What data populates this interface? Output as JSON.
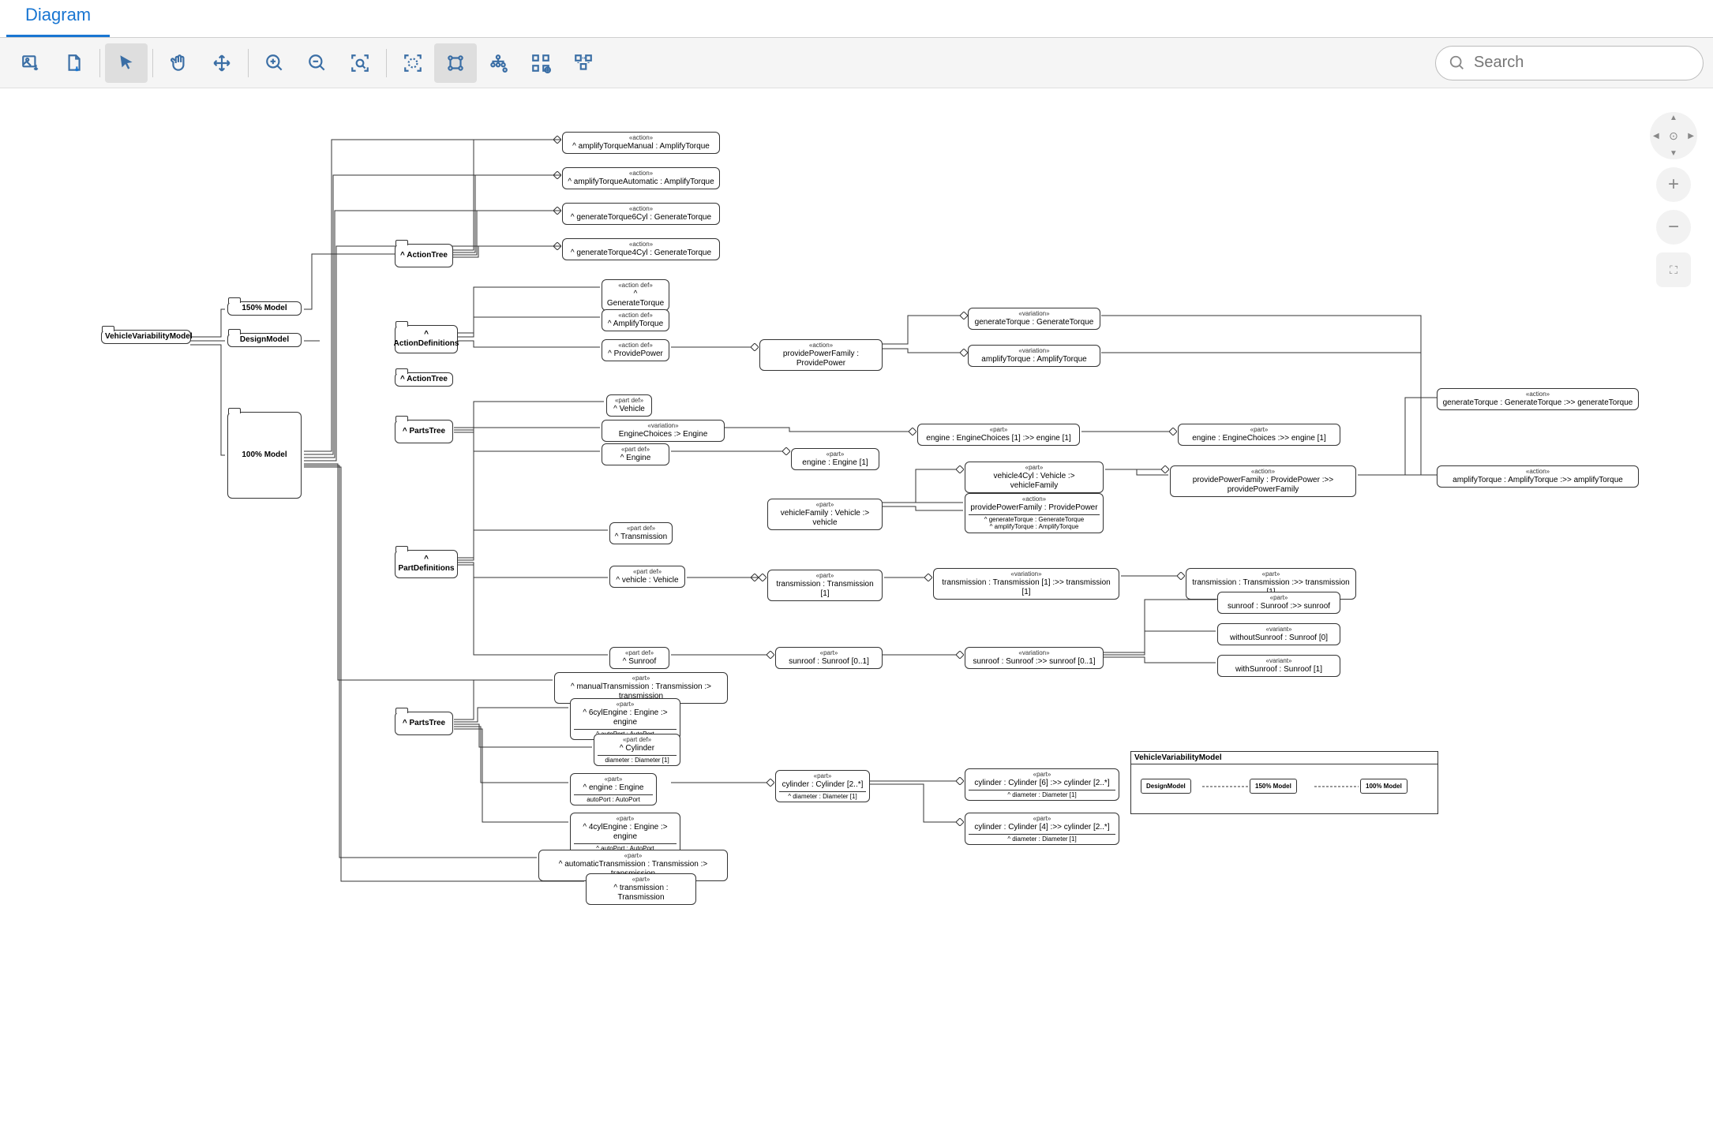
{
  "tab": {
    "label": "Diagram"
  },
  "search": {
    "placeholder": "Search"
  },
  "toolbar": {
    "tools": [
      {
        "name": "image-export-icon"
      },
      {
        "name": "page-icon"
      },
      {
        "name": "pointer-icon",
        "active": true
      },
      {
        "name": "pan-icon"
      },
      {
        "name": "move-icon"
      },
      {
        "name": "zoom-in-icon"
      },
      {
        "name": "zoom-out-icon"
      },
      {
        "name": "zoom-region-icon"
      },
      {
        "name": "fit-icon"
      },
      {
        "name": "layout-icon",
        "active": true
      },
      {
        "name": "layout-tree-icon"
      },
      {
        "name": "distribute-icon"
      },
      {
        "name": "align-icon"
      }
    ]
  },
  "nodes": {
    "root": "VehicleVariabilityModel",
    "model150a": "150% Model",
    "designModel": "DesignModel",
    "model100": "100% Model",
    "actionTree1": "^ ActionTree",
    "actionTree2": "^ ActionTree",
    "actionDefs": "^ ActionDefinitions",
    "partsTree1": "^ PartsTree",
    "partDefs": "^ PartDefinitions",
    "partsTree2": "^ PartsTree",
    "amplifyManual": {
      "stereo": "«action»",
      "label": "^ amplifyTorqueManual : AmplifyTorque"
    },
    "amplifyAuto": {
      "stereo": "«action»",
      "label": "^ amplifyTorqueAutomatic : AmplifyTorque"
    },
    "genTorque6": {
      "stereo": "«action»",
      "label": "^ generateTorque6Cyl : GenerateTorque"
    },
    "genTorque4": {
      "stereo": "«action»",
      "label": "^ generateTorque4Cyl : GenerateTorque"
    },
    "genTorqueDef": {
      "stereo": "«action def»",
      "label": "^ GenerateTorque"
    },
    "amplifyDef": {
      "stereo": "«action def»",
      "label": "^ AmplifyTorque"
    },
    "providePowerDef": {
      "stereo": "«action def»",
      "label": "^ ProvidePower"
    },
    "providePowerFamily": {
      "stereo": "«action»",
      "label": "providePowerFamily : ProvidePower"
    },
    "genTorqueVar": {
      "stereo": "«variation»",
      "label": "generateTorque : GenerateTorque"
    },
    "amplifyVar": {
      "stereo": "«variation»",
      "label": "amplifyTorque : AmplifyTorque"
    },
    "genTorqueAction": {
      "stereo": "«action»",
      "label": "generateTorque : GenerateTorque :>> generateTorque"
    },
    "amplifyAction": {
      "stereo": "«action»",
      "label": "amplifyTorque : AmplifyTorque :>> amplifyTorque"
    },
    "vehicleDef": {
      "stereo": "«part def»",
      "label": "^ Vehicle"
    },
    "engineChoicesVar": {
      "stereo": "«variation»",
      "label": "EngineChoices :> Engine"
    },
    "engineDef": {
      "stereo": "«part def»",
      "label": "^ Engine"
    },
    "enginePart": {
      "stereo": "«part»",
      "label": "engine : Engine [1]"
    },
    "engineChoicesPart": {
      "stereo": "«part»",
      "label": "engine : EngineChoices [1] :>> engine [1]"
    },
    "engineChoicesPart2": {
      "stereo": "«part»",
      "label": "engine : EngineChoices :>> engine [1]"
    },
    "vehicle4Cyl": {
      "stereo": "«part»",
      "label": "vehicle4Cyl : Vehicle :> vehicleFamily"
    },
    "vehicleFamily": {
      "stereo": "«part»",
      "label": "vehicleFamily : Vehicle :> vehicle"
    },
    "providePowerFamily2": {
      "stereo": "«action»",
      "label": "providePowerFamily : ProvidePower",
      "c1": "^ generateTorque : GenerateTorque",
      "c2": "^ amplifyTorque : AmplifyTorque"
    },
    "providePowerAction": {
      "stereo": "«action»",
      "label": "providePowerFamily : ProvidePower :>> providePowerFamily"
    },
    "transmissionDef": {
      "stereo": "«part def»",
      "label": "^ Transmission"
    },
    "vehicleDef2": {
      "stereo": "«part def»",
      "label": "^ vehicle : Vehicle"
    },
    "transmissionPart": {
      "stereo": "«part»",
      "label": "transmission : Transmission [1]"
    },
    "transmissionVar": {
      "stereo": "«variation»",
      "label": "transmission : Transmission [1] :>> transmission [1]"
    },
    "transmissionPart2": {
      "stereo": "«part»",
      "label": "transmission : Transmission :>> transmission [1]"
    },
    "sunroofPart": {
      "stereo": "«part»",
      "label": "sunroof : Sunroof :>> sunroof"
    },
    "withoutSunroof": {
      "stereo": "«variant»",
      "label": "withoutSunroof : Sunroof [0]"
    },
    "withSunroof": {
      "stereo": "«variant»",
      "label": "withSunroof : Sunroof [1]"
    },
    "sunroofDef": {
      "stereo": "«part def»",
      "label": "^ Sunroof"
    },
    "sunroofPart01": {
      "stereo": "«part»",
      "label": "sunroof : Sunroof [0..1]"
    },
    "sunroofVar": {
      "stereo": "«variation»",
      "label": "sunroof : Sunroof :>> sunroof [0..1]"
    },
    "manualTrans": {
      "stereo": "«part»",
      "label": "^ manualTransmission : Transmission :> transmission"
    },
    "sixCylEngine": {
      "stereo": "«part»",
      "label": "^ 6cylEngine : Engine :> engine",
      "c1": "^ autoPort : AutoPort"
    },
    "cylinderDef": {
      "stereo": "«part def»",
      "label": "^ Cylinder",
      "c1": "diameter : Diameter [1]"
    },
    "engineEngine": {
      "stereo": "«part»",
      "label": "^ engine : Engine",
      "c1": "autoPort : AutoPort"
    },
    "cylinderPart": {
      "stereo": "«part»",
      "label": "cylinder : Cylinder [2..*]",
      "c1": "^ diameter : Diameter [1]"
    },
    "cylinder6": {
      "stereo": "«part»",
      "label": "cylinder : Cylinder [6] :>> cylinder [2..*]",
      "c1": "^ diameter : Diameter [1]"
    },
    "cylinder4": {
      "stereo": "«part»",
      "label": "cylinder : Cylinder [4] :>> cylinder [2..*]",
      "c1": "^ diameter : Diameter [1]"
    },
    "fourCylEngine": {
      "stereo": "«part»",
      "label": "^ 4cylEngine : Engine :> engine",
      "c1": "^ autoPort : AutoPort"
    },
    "autoTrans": {
      "stereo": "«part»",
      "label": "^ automaticTransmission : Transmission :> transmission"
    },
    "transTrans": {
      "stereo": "«part»",
      "label": "^ transmission : Transmission"
    }
  },
  "inset": {
    "title": "VehicleVariabilityModel",
    "items": [
      "DesignModel",
      "150% Model",
      "100% Model"
    ]
  }
}
